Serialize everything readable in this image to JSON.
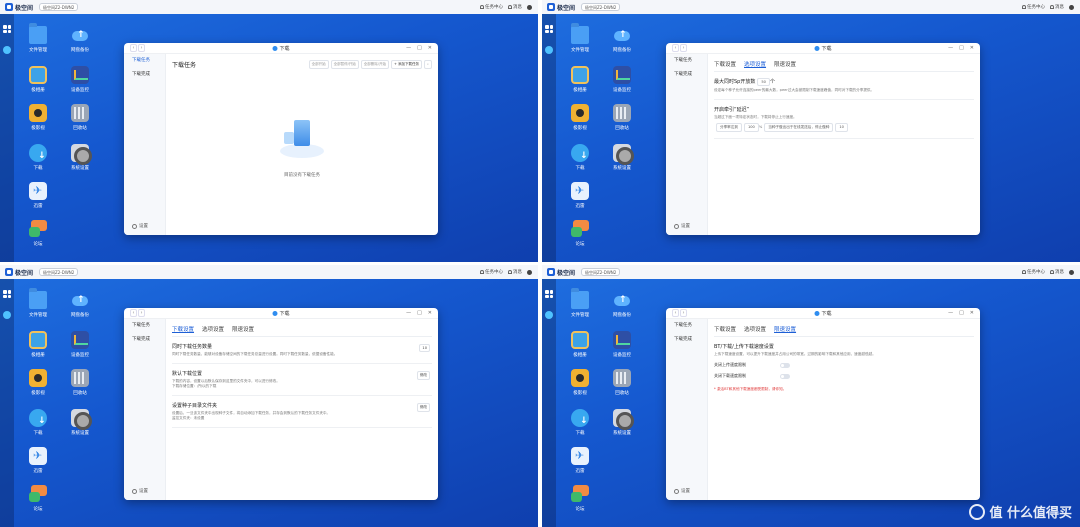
{
  "app": {
    "brand": "极空间",
    "device": "极空间Z2-DWN2",
    "task_center": "任务中心",
    "notify": "消息"
  },
  "desktop_icons": [
    {
      "label": "文件管理",
      "icon": "folder-icon"
    },
    {
      "label": "网盘备份",
      "icon": "cloud-upload-icon"
    },
    {
      "label": "极相册",
      "icon": "photo-icon"
    },
    {
      "label": "设备监控",
      "icon": "monitor-icon"
    },
    {
      "label": "极影视",
      "icon": "video-icon"
    },
    {
      "label": "回收站",
      "icon": "trash-icon"
    },
    {
      "label": "下载",
      "icon": "download-icon"
    },
    {
      "label": "系统设置",
      "icon": "gear-icon"
    },
    {
      "label": "迅雷",
      "icon": "bird-icon"
    },
    {
      "label": "论坛",
      "icon": "chat-icon"
    }
  ],
  "window": {
    "title": "下载",
    "side_items": [
      "下载任务",
      "下载完成"
    ],
    "settings_label": "设置"
  },
  "q0": {
    "heading": "下载任务",
    "buttons": [
      "全部开始",
      "全部暂停/开始",
      "全部删除/开始",
      "+ 添加下载任务"
    ],
    "empty_text": "目前没有下载任务"
  },
  "tabs": [
    "下载设置",
    "选项设置",
    "限速设置"
  ],
  "q1": {
    "sec1_title": "最大同时Sp开放数",
    "sec1_value": "50",
    "sec1_unit": "个",
    "sec1_desc": "设定每个种子允许连接的peer的最大数，peer过大会被限制下载速度峰值，同时对下载的分享提供。",
    "sec2_title": "开启牵引“延迟”",
    "sec2_desc": "当超过下面一项特定状态时，下载将停止上行速度。",
    "share_label": "分享率达到",
    "share_value": "100",
    "share_unit": "%",
    "seed_label": "当种子做出出于在线发送后，停止做种",
    "seed_value": "10"
  },
  "q2": {
    "sec1_title": "同时下载任务数量",
    "sec1_desc": "同时下载任务数量，能够对设备存储空间的下载任务总量进行设置。同时下载任务数量，依据设备性能。",
    "sec1_value": "10",
    "sec2_title": "默认下载位置",
    "sec2_desc": "下载的内容，设置以后默认保存到这里的文件夹中，可以进行修改。",
    "sec2_path_label": "下载存储位置：",
    "sec2_path": "/所以的下载",
    "sec2_btn": "修改",
    "sec3_title": "设置种子目录文件夹",
    "sec3_desc": "设置后，一旦该文件夹中出现种子文件，将自动添加下载任务，并存会到默认的下载任务文件夹中。",
    "sec3_path_label": "监控文件夹：",
    "sec3_path": "未设置",
    "sec3_btn": "修改"
  },
  "q3": {
    "title": "BT/下载/上传下载速度设置",
    "desc": "上传下载速度设置，可以提升下载速度并占用公司的带宽。过期的影响下载和其他应用，速度越低越。",
    "toggle1": "关闭上传速度限制",
    "toggle2": "关闭下载速度限制",
    "warning": "* 激活BT和其他下载速度都受限制，请你知。"
  },
  "watermark": "值 什么值得买"
}
